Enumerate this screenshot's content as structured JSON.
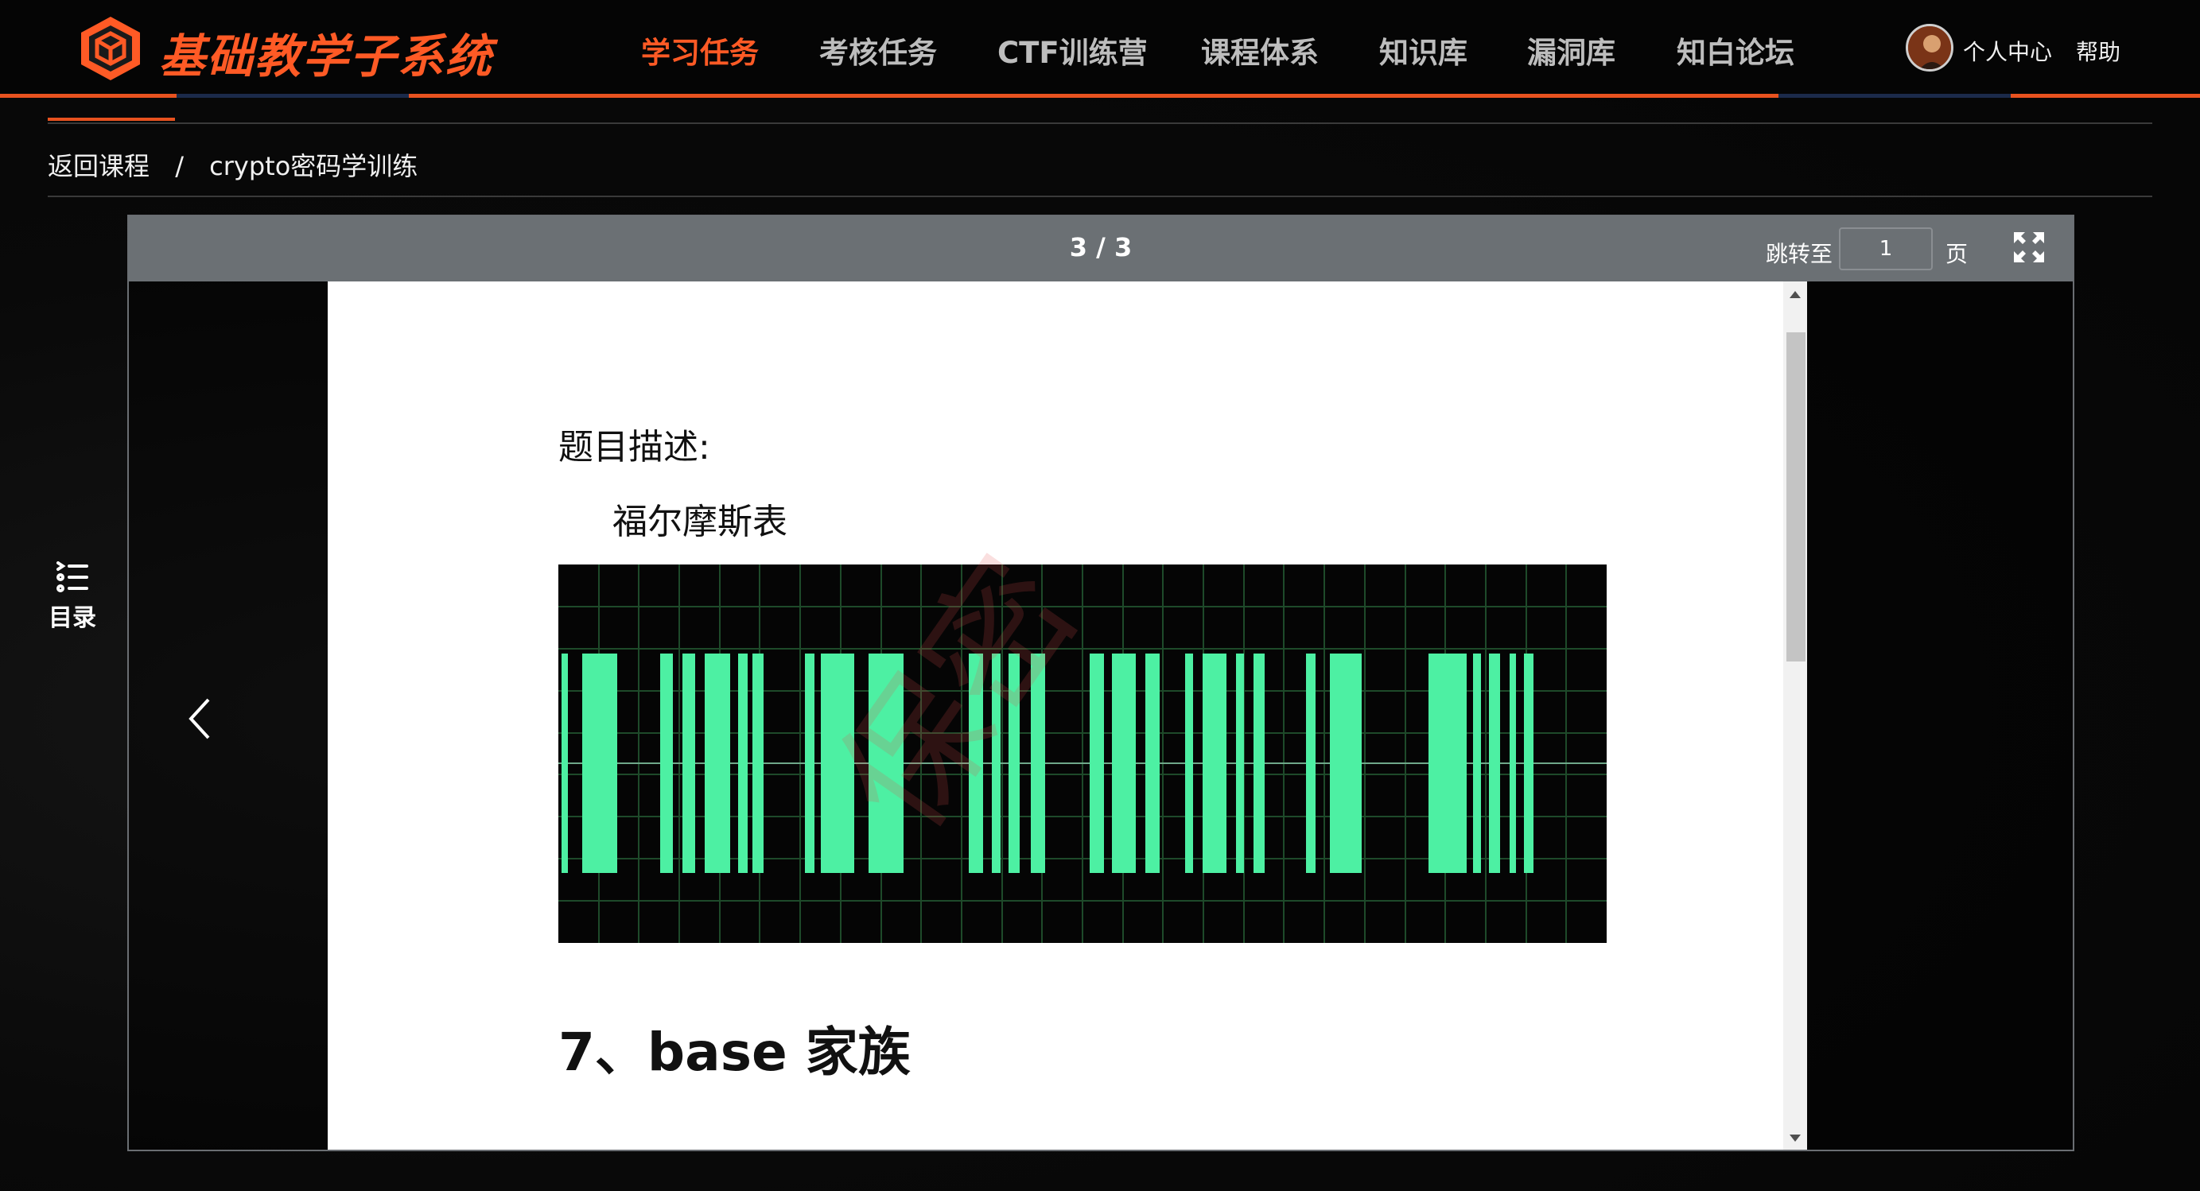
{
  "header": {
    "brand": "基础教学子系统",
    "nav": [
      {
        "label": "学习任务",
        "active": true
      },
      {
        "label": "考核任务",
        "active": false
      },
      {
        "label": "CTF训练营",
        "active": false
      },
      {
        "label": "课程体系",
        "active": false
      },
      {
        "label": "知识库",
        "active": false
      },
      {
        "label": "漏洞库",
        "active": false
      },
      {
        "label": "知白论坛",
        "active": false
      }
    ],
    "user_center": "个人中心",
    "help": "帮助",
    "accent_color": "#ff5a25"
  },
  "breadcrumb": {
    "back": "返回课程",
    "separator": "/",
    "current": "crypto密码学训练"
  },
  "viewer": {
    "page_indicator": "3 / 3",
    "jump_label": "跳转至",
    "jump_value": "1",
    "page_unit": "页",
    "toc_label": "目录"
  },
  "document": {
    "prompt_label": "题目描述:",
    "item": "福尔摩斯表",
    "section_title": "7、base 家族",
    "signal_bar_color": "#4df0a3"
  }
}
